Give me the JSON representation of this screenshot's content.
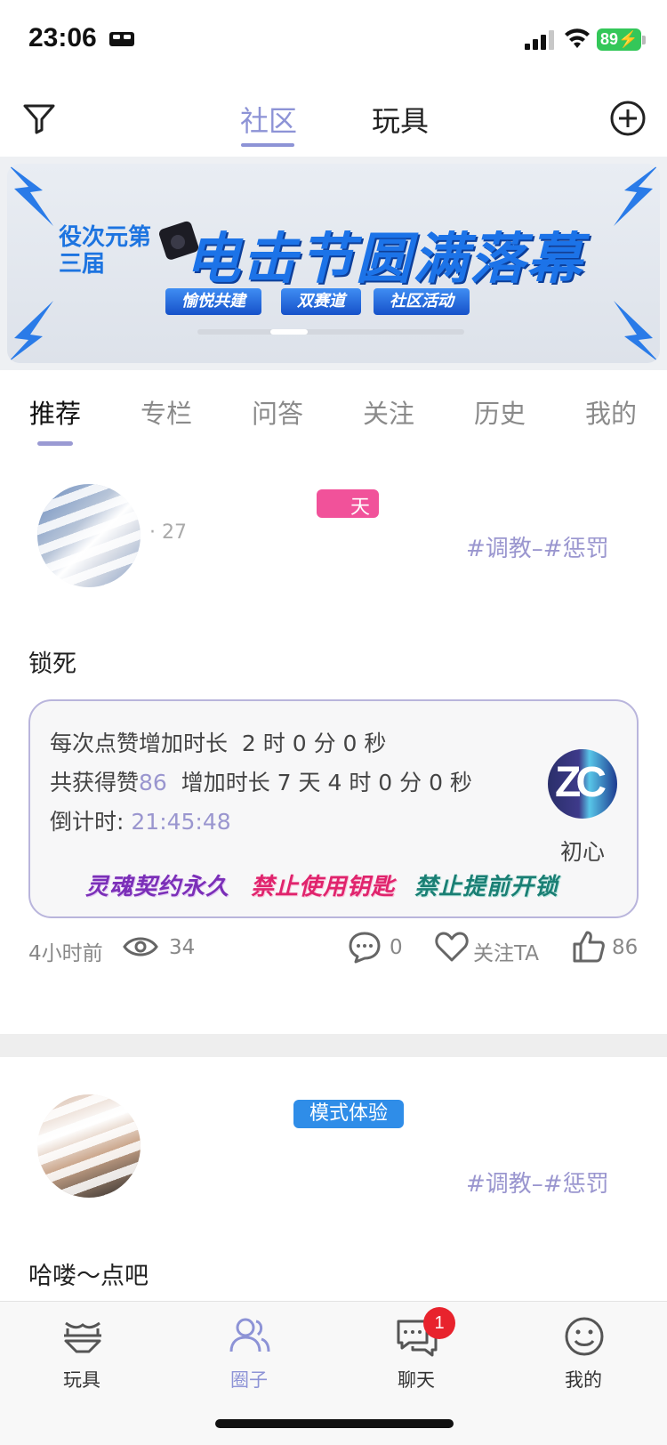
{
  "status_bar": {
    "time": "23:06",
    "battery": "89"
  },
  "top_nav": {
    "tab_community": "社区",
    "tab_toys": "玩具"
  },
  "banner": {
    "small_title": "役次元第三届",
    "title": "电击节圆满落幕",
    "tags": [
      "愉悦共建",
      "双赛道",
      "社区活动"
    ]
  },
  "sub_tabs": [
    "推荐",
    "专栏",
    "问答",
    "关注",
    "历史",
    "我的"
  ],
  "post1": {
    "badge": "天",
    "meta_partial": "27",
    "hashtags": "#调教–#惩罚",
    "text": "锁死",
    "lock": {
      "row1_label": "每次点赞增加时长",
      "row1_value": "2 时 0 分 0 秒",
      "row2_label": "共获得赞",
      "row2_likes": "86",
      "row2_value": "增加时长 7 天 4 时 0 分 0 秒",
      "row3_label": "倒计时:",
      "row3_value": "21:45:48",
      "keyholder_initials": "ZC",
      "keyholder_name": "初心",
      "badges": [
        "灵魂契约永久",
        "禁止使用钥匙",
        "禁止提前开锁"
      ]
    },
    "footer": {
      "time": "4小时前",
      "views": "34",
      "comments": "0",
      "follow": "关注TA",
      "likes": "86"
    }
  },
  "post2": {
    "badge": "模式体验",
    "hashtags": "#调教–#惩罚",
    "text": "哈喽～点吧"
  },
  "bottom_nav": {
    "items": [
      {
        "label": "玩具"
      },
      {
        "label": "圈子"
      },
      {
        "label": "聊天"
      },
      {
        "label": "我的"
      }
    ],
    "chat_badge": "1"
  },
  "colors": {
    "accent": "#8d93d6",
    "pink_badge": "#f1529a",
    "blue_badge": "#2f8de8",
    "notification": "#e8232d"
  }
}
